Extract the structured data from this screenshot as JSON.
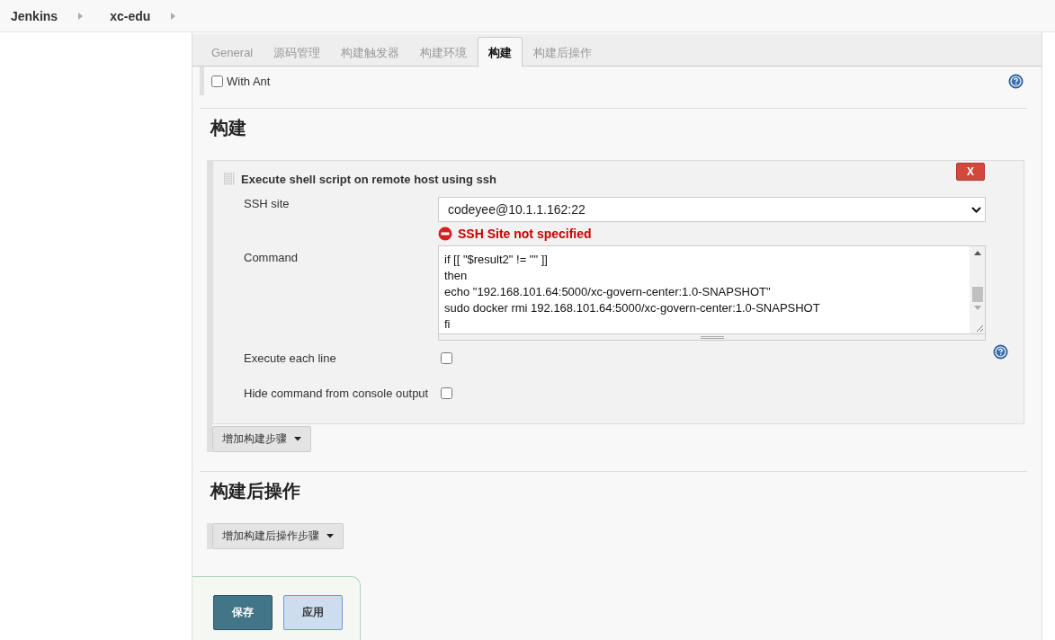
{
  "breadcrumbs": [
    {
      "label": "Jenkins"
    },
    {
      "label": "xc-edu"
    }
  ],
  "tabs": [
    {
      "label": "General",
      "selected": false
    },
    {
      "label": "源码管理",
      "selected": false
    },
    {
      "label": "构建触发器",
      "selected": false
    },
    {
      "label": "构建环境",
      "selected": false
    },
    {
      "label": "构建",
      "selected": true
    },
    {
      "label": "构建后操作",
      "selected": false
    }
  ],
  "with_ant": {
    "label": "With Ant",
    "checked": false
  },
  "build_section": {
    "heading": "构建",
    "step": {
      "title": "Execute shell script on remote host using ssh",
      "delete_label": "X",
      "ssh_site": {
        "label": "SSH site",
        "value": "codeyee@10.1.1.162:22",
        "error": "SSH Site not specified"
      },
      "command": {
        "label": "Command",
        "lines": [
          "if [[ \"$result2\" != \"\" ]]",
          "then",
          "echo \"192.168.101.64:5000/xc-govern-center:1.0-SNAPSHOT\"",
          "sudo docker rmi 192.168.101.64:5000/xc-govern-center:1.0-SNAPSHOT",
          "fi"
        ]
      },
      "options": [
        {
          "label": "Execute each line",
          "checked": false
        },
        {
          "label": "Hide command from console output",
          "checked": false
        }
      ]
    },
    "add_button": "增加构建步骤"
  },
  "post_build_section": {
    "heading": "构建后操作",
    "add_button": "增加构建后操作步骤"
  },
  "buttons": [
    {
      "label": "保存",
      "kind": "primary"
    },
    {
      "label": "应用",
      "kind": "secondary"
    }
  ]
}
